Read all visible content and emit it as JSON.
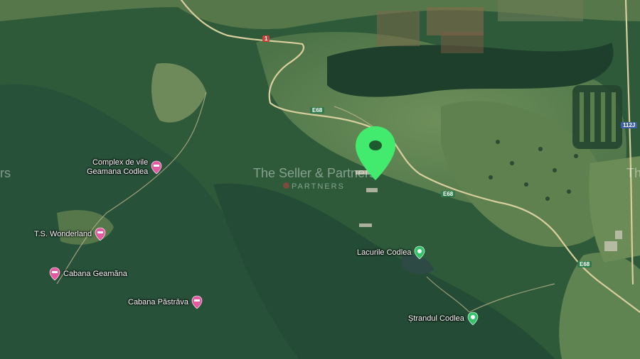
{
  "map": {
    "pois": [
      {
        "name": "Complex de vile\nGeamana Codlea",
        "line1": "Complex de vile",
        "line2": "Geamana Codlea",
        "type": "lodging",
        "color": "#e25aa0"
      },
      {
        "name": "T.S. Wonderland",
        "type": "lodging",
        "color": "#e25aa0"
      },
      {
        "name": "Cabana Geamăna",
        "type": "lodging",
        "color": "#e25aa0"
      },
      {
        "name": "Cabana Păstrăva",
        "type": "lodging",
        "color": "#e25aa0"
      },
      {
        "name": "Lacurile Codlea",
        "type": "park",
        "color": "#33c46a"
      },
      {
        "name": "Ștrandul Codlea",
        "type": "park",
        "color": "#33c46a"
      }
    ],
    "roads": {
      "e68_a": "E68",
      "e68_b": "E68",
      "e68_c": "E68",
      "route_1": "1",
      "route_112j": "112J"
    },
    "watermark": {
      "main": "The Seller & Partners",
      "sub": "PARTNERS",
      "edge_left": "rs",
      "edge_right": "Th"
    },
    "marker": {
      "color": "#3fe86c",
      "icon": "location-pin-icon"
    }
  }
}
